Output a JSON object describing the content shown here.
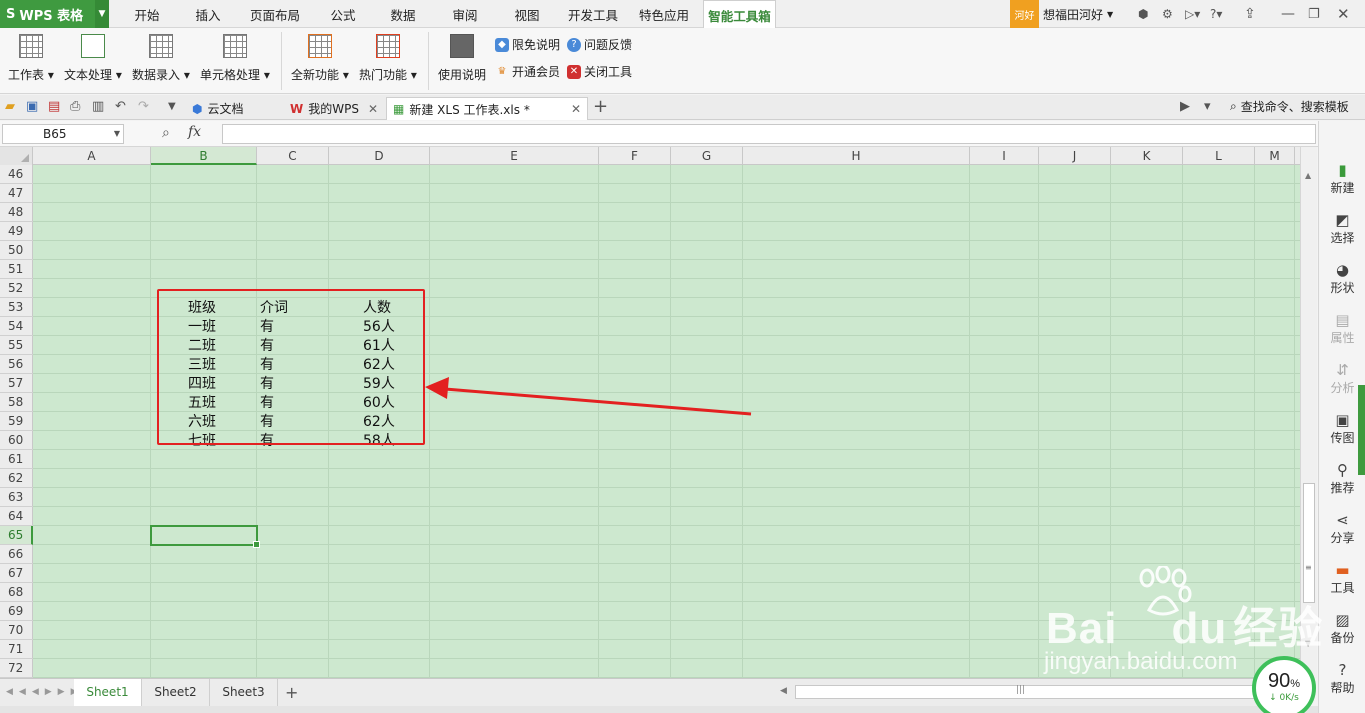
{
  "app": {
    "title": "WPS 表格",
    "logo": "S"
  },
  "menu": {
    "items": [
      "开始",
      "插入",
      "页面布局",
      "公式",
      "数据",
      "审阅",
      "视图",
      "开发工具",
      "特色应用",
      "智能工具箱"
    ],
    "active": "智能工具箱"
  },
  "user": {
    "badge": "河好",
    "name": "想福田河好"
  },
  "ribbon": {
    "buttons": [
      "工作表",
      "文本处理",
      "数据录入",
      "单元格处理",
      "全新功能",
      "热门功能",
      "使用说明"
    ],
    "small": [
      "限免说明",
      "问题反馈",
      "开通会员",
      "关闭工具"
    ]
  },
  "tabs": {
    "items": [
      "云文档",
      "我的WPS",
      "新建 XLS 工作表.xls *"
    ],
    "search": "查找命令、搜索模板"
  },
  "formula": {
    "namebox": "B65",
    "fx": "fx",
    "value": ""
  },
  "columns": [
    "A",
    "B",
    "C",
    "D",
    "E",
    "F",
    "G",
    "H",
    "I",
    "J",
    "K",
    "L",
    "M"
  ],
  "rows": [
    "46",
    "47",
    "48",
    "49",
    "50",
    "51",
    "52",
    "53",
    "54",
    "55",
    "56",
    "57",
    "58",
    "59",
    "60",
    "61",
    "62",
    "63",
    "64",
    "65",
    "66",
    "67",
    "68",
    "69",
    "70",
    "71",
    "72"
  ],
  "selected": {
    "column": "B",
    "row": "65"
  },
  "table": {
    "header": [
      "班级",
      "介词",
      "人数"
    ],
    "rows": [
      [
        "一班",
        "有",
        "56人"
      ],
      [
        "二班",
        "有",
        "61人"
      ],
      [
        "三班",
        "有",
        "62人"
      ],
      [
        "四班",
        "有",
        "59人"
      ],
      [
        "五班",
        "有",
        "60人"
      ],
      [
        "六班",
        "有",
        "62人"
      ],
      [
        "七班",
        "有",
        "58人"
      ]
    ]
  },
  "sidepanel": {
    "items": [
      "新建",
      "选择",
      "形状",
      "属性",
      "分析",
      "传图",
      "推荐",
      "分享",
      "工具",
      "备份",
      "帮助"
    ],
    "disabled": [
      "属性",
      "分析"
    ]
  },
  "sheets": {
    "items": [
      "Sheet1",
      "Sheet2",
      "Sheet3"
    ],
    "active": "Sheet1"
  },
  "speed": {
    "percent": "90",
    "unit": "%",
    "rate": "0K/s"
  },
  "watermark": {
    "brand": "Bai",
    "brand2": "du",
    "cn": "经验",
    "url": "jingyan.baidu.com"
  },
  "colors": {
    "accent": "#3f9a40",
    "sheet_bg": "#cde8cf",
    "annotation": "#e32020"
  }
}
